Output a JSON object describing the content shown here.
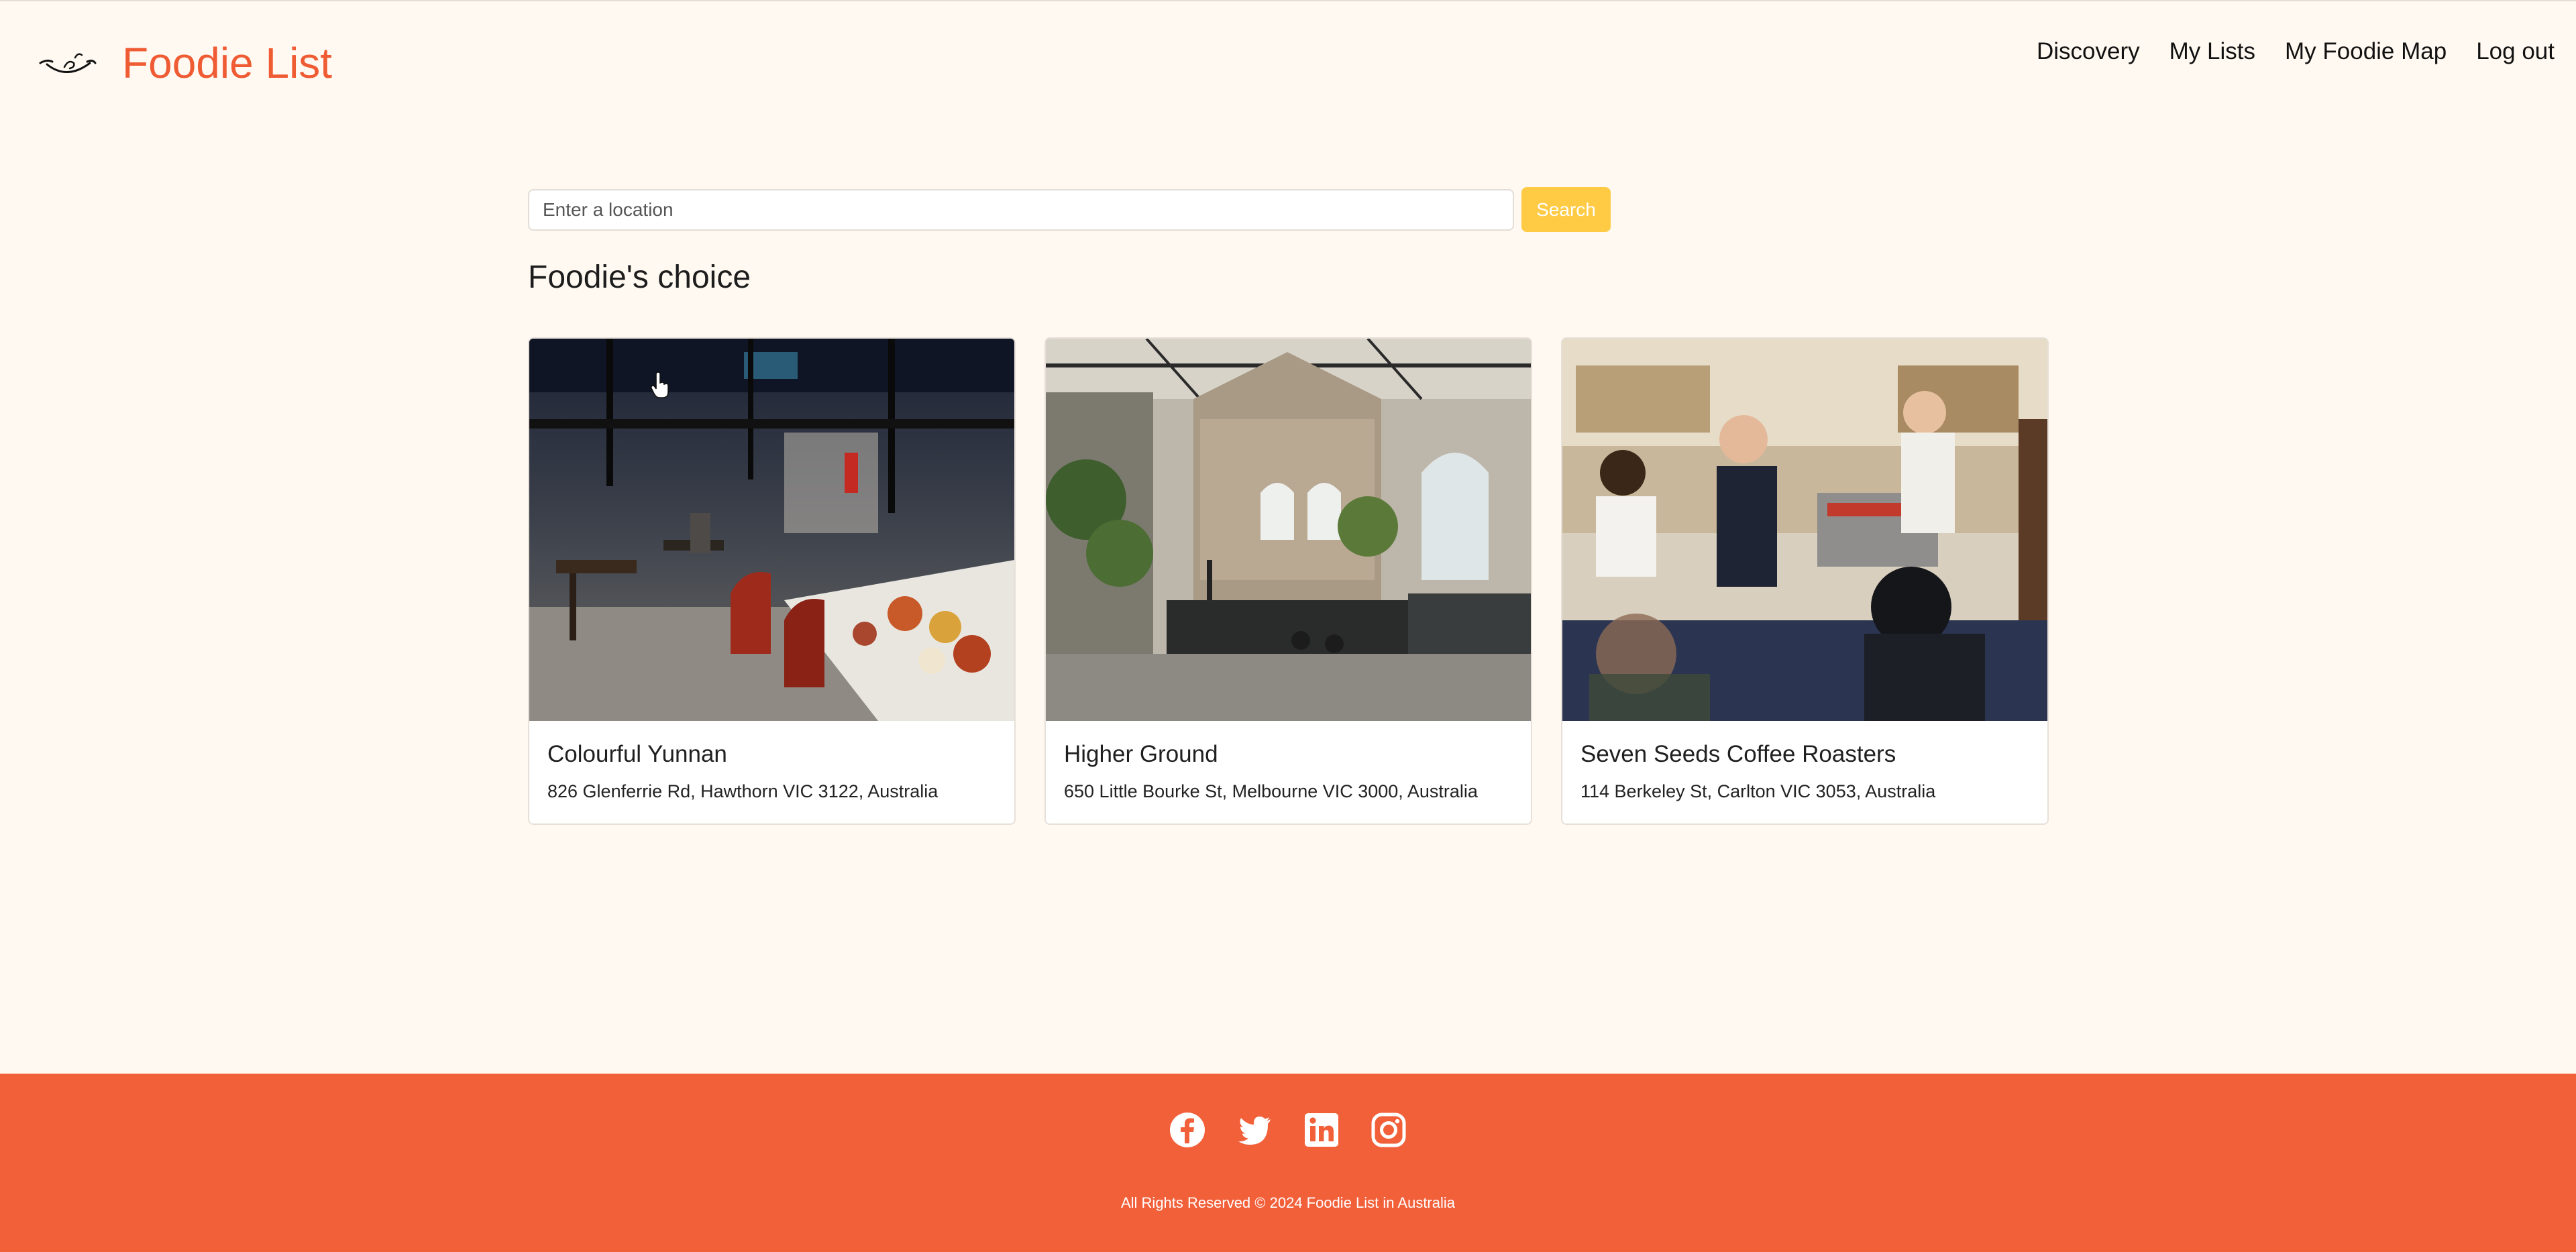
{
  "header": {
    "brand_name": "Foodie List",
    "logo_icon": "smile-logo-icon",
    "nav": [
      "Discovery",
      "My Lists",
      "My Foodie Map",
      "Log out"
    ]
  },
  "search": {
    "placeholder": "Enter a location",
    "value": "",
    "button_label": "Search"
  },
  "section": {
    "title": "Foodie's choice"
  },
  "cards": [
    {
      "name": "Colourful Yunnan",
      "address": "826 Glenferrie Rd, Hawthorn VIC 3122, Australia",
      "image": "restaurant-interior-photo"
    },
    {
      "name": "Higher Ground",
      "address": "650 Little Bourke St, Melbourne VIC 3000, Australia",
      "image": "cafe-hall-photo"
    },
    {
      "name": "Seven Seeds Coffee Roasters",
      "address": "114 Berkeley St, Carlton VIC 3053, Australia",
      "image": "coffee-bar-photo"
    }
  ],
  "footer": {
    "social_icons": [
      "facebook-icon",
      "twitter-icon",
      "linkedin-icon",
      "instagram-icon"
    ],
    "copyright": "All Rights Reserved © 2024 Foodie List in Australia"
  },
  "colors": {
    "brand": "#ef5b33",
    "background": "#fff9f1",
    "search_button": "#ffcb45",
    "footer": "#f2603a"
  }
}
